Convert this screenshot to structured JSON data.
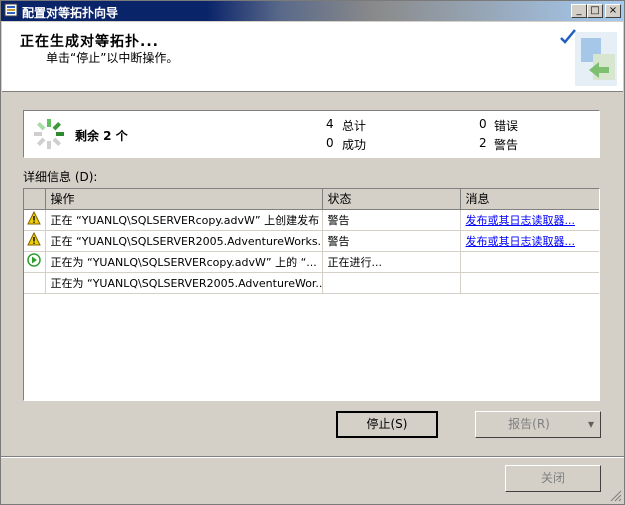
{
  "window": {
    "title": "配置对等拓扑向导"
  },
  "header": {
    "title": "正在生成对等拓扑...",
    "subtitle": "单击“停止”以中断操作。"
  },
  "summary": {
    "remaining": "剩余 2 个",
    "total_count": "4",
    "total_label": "总计",
    "success_count": "0",
    "success_label": "成功",
    "error_count": "0",
    "error_label": "错误",
    "warning_count": "2",
    "warning_label": "警告"
  },
  "details_label": "详细信息 (D):",
  "table": {
    "columns": [
      "操作",
      "状态",
      "消息"
    ],
    "rows": [
      {
        "icon": "warning-icon",
        "action": "正在 “YUANLQ\\SQLSERVERcopy.advW” 上创建发布",
        "status": "警告",
        "message": "发布或其日志读取器..."
      },
      {
        "icon": "warning-icon",
        "action": "正在 “YUANLQ\\SQLSERVER2005.AdventureWorks...",
        "status": "警告",
        "message": "发布或其日志读取器..."
      },
      {
        "icon": "in-progress-icon",
        "action": "正在为 “YUANLQ\\SQLSERVERcopy.advW” 上的 “...",
        "status": "正在进行...",
        "message": ""
      },
      {
        "icon": "",
        "action": "正在为 “YUANLQ\\SQLSERVER2005.AdventureWor...",
        "status": "",
        "message": ""
      }
    ]
  },
  "buttons": {
    "stop": "停止(S)",
    "report": "报告(R)",
    "close": "关闭"
  },
  "colors": {
    "titlebar": "#0a246a",
    "face": "#d4d0c8",
    "link": "#0000ff",
    "warning": "#f0d000",
    "progress": "#2e9e2e"
  }
}
